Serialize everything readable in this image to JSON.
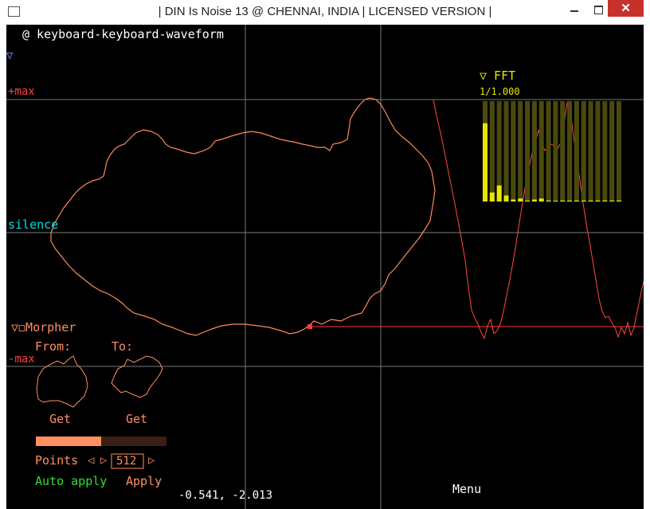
{
  "window": {
    "title": "| DIN Is Noise 13 @ CHENNAI, INDIA | LICENSED VERSION |",
    "close_glyph": "✕"
  },
  "editor": {
    "name": "@ keyboard-keyboard-waveform",
    "collapse_glyph": "▽",
    "ref_lines": {
      "plus_max": "+max",
      "silence": "silence",
      "minus_max": "-max"
    }
  },
  "fft": {
    "label": "▽ FFT",
    "scale": "1/1.000",
    "bars": [
      0.78,
      0.09,
      0.16,
      0.06,
      0.02,
      0.03,
      0.01,
      0.02,
      0.03,
      0.01,
      0.0,
      0.01,
      0.01,
      0.01,
      0.01,
      0.01,
      0.01,
      0.01,
      0.01,
      0.01
    ]
  },
  "morpher": {
    "label": "▽◻Morpher",
    "from_label": "From:",
    "to_label": "To:",
    "get_from": "Get",
    "get_to": "Get",
    "morph_amount": 0.5,
    "points_label": "Points",
    "points_decrease": "◁",
    "points_increase": "▷",
    "points_value": "512",
    "auto_apply": "Auto apply",
    "apply": "Apply"
  },
  "status": {
    "cursor": "-0.541, -2.013",
    "menu": "Menu"
  },
  "colors": {
    "background": "#000000",
    "grid": "#7a7a7a",
    "waveform": "#ff8a5a",
    "oscilloscope": "#ff4a3a",
    "cursor_line": "#ff3b3b",
    "ref_red": "#ff4040",
    "silence_cyan": "#00e0e0",
    "fft_yellow": "#e6e600",
    "fft_bg": "#4a4a10",
    "morpher_orange": "#ff9060",
    "green": "#30e030",
    "blue": "#6a8cff"
  }
}
